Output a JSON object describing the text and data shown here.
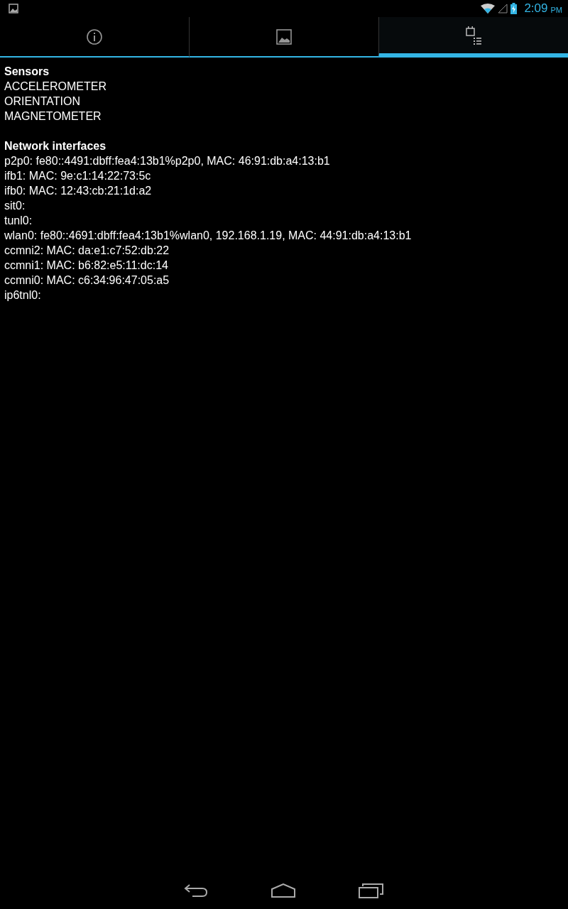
{
  "status_bar": {
    "time": "2:09",
    "ampm": "PM"
  },
  "tabs": [
    {
      "kind": "info",
      "selected": false
    },
    {
      "kind": "image",
      "selected": false
    },
    {
      "kind": "list",
      "selected": true
    }
  ],
  "sections": [
    {
      "title": "Sensors",
      "lines": [
        "ACCELEROMETER",
        "ORIENTATION",
        "MAGNETOMETER"
      ]
    },
    {
      "title": "Network interfaces",
      "lines": [
        "p2p0: fe80::4491:dbff:fea4:13b1%p2p0, MAC: 46:91:db:a4:13:b1",
        "ifb1: MAC: 9e:c1:14:22:73:5c",
        "ifb0: MAC: 12:43:cb:21:1d:a2",
        "sit0:",
        "tunl0:",
        "wlan0: fe80::4691:dbff:fea4:13b1%wlan0, 192.168.1.19, MAC: 44:91:db:a4:13:b1",
        "ccmni2: MAC: da:e1:c7:52:db:22",
        "ccmni1: MAC: b6:82:e5:11:dc:14",
        "ccmni0: MAC: c6:34:96:47:05:a5",
        "ip6tnl0:"
      ]
    }
  ]
}
